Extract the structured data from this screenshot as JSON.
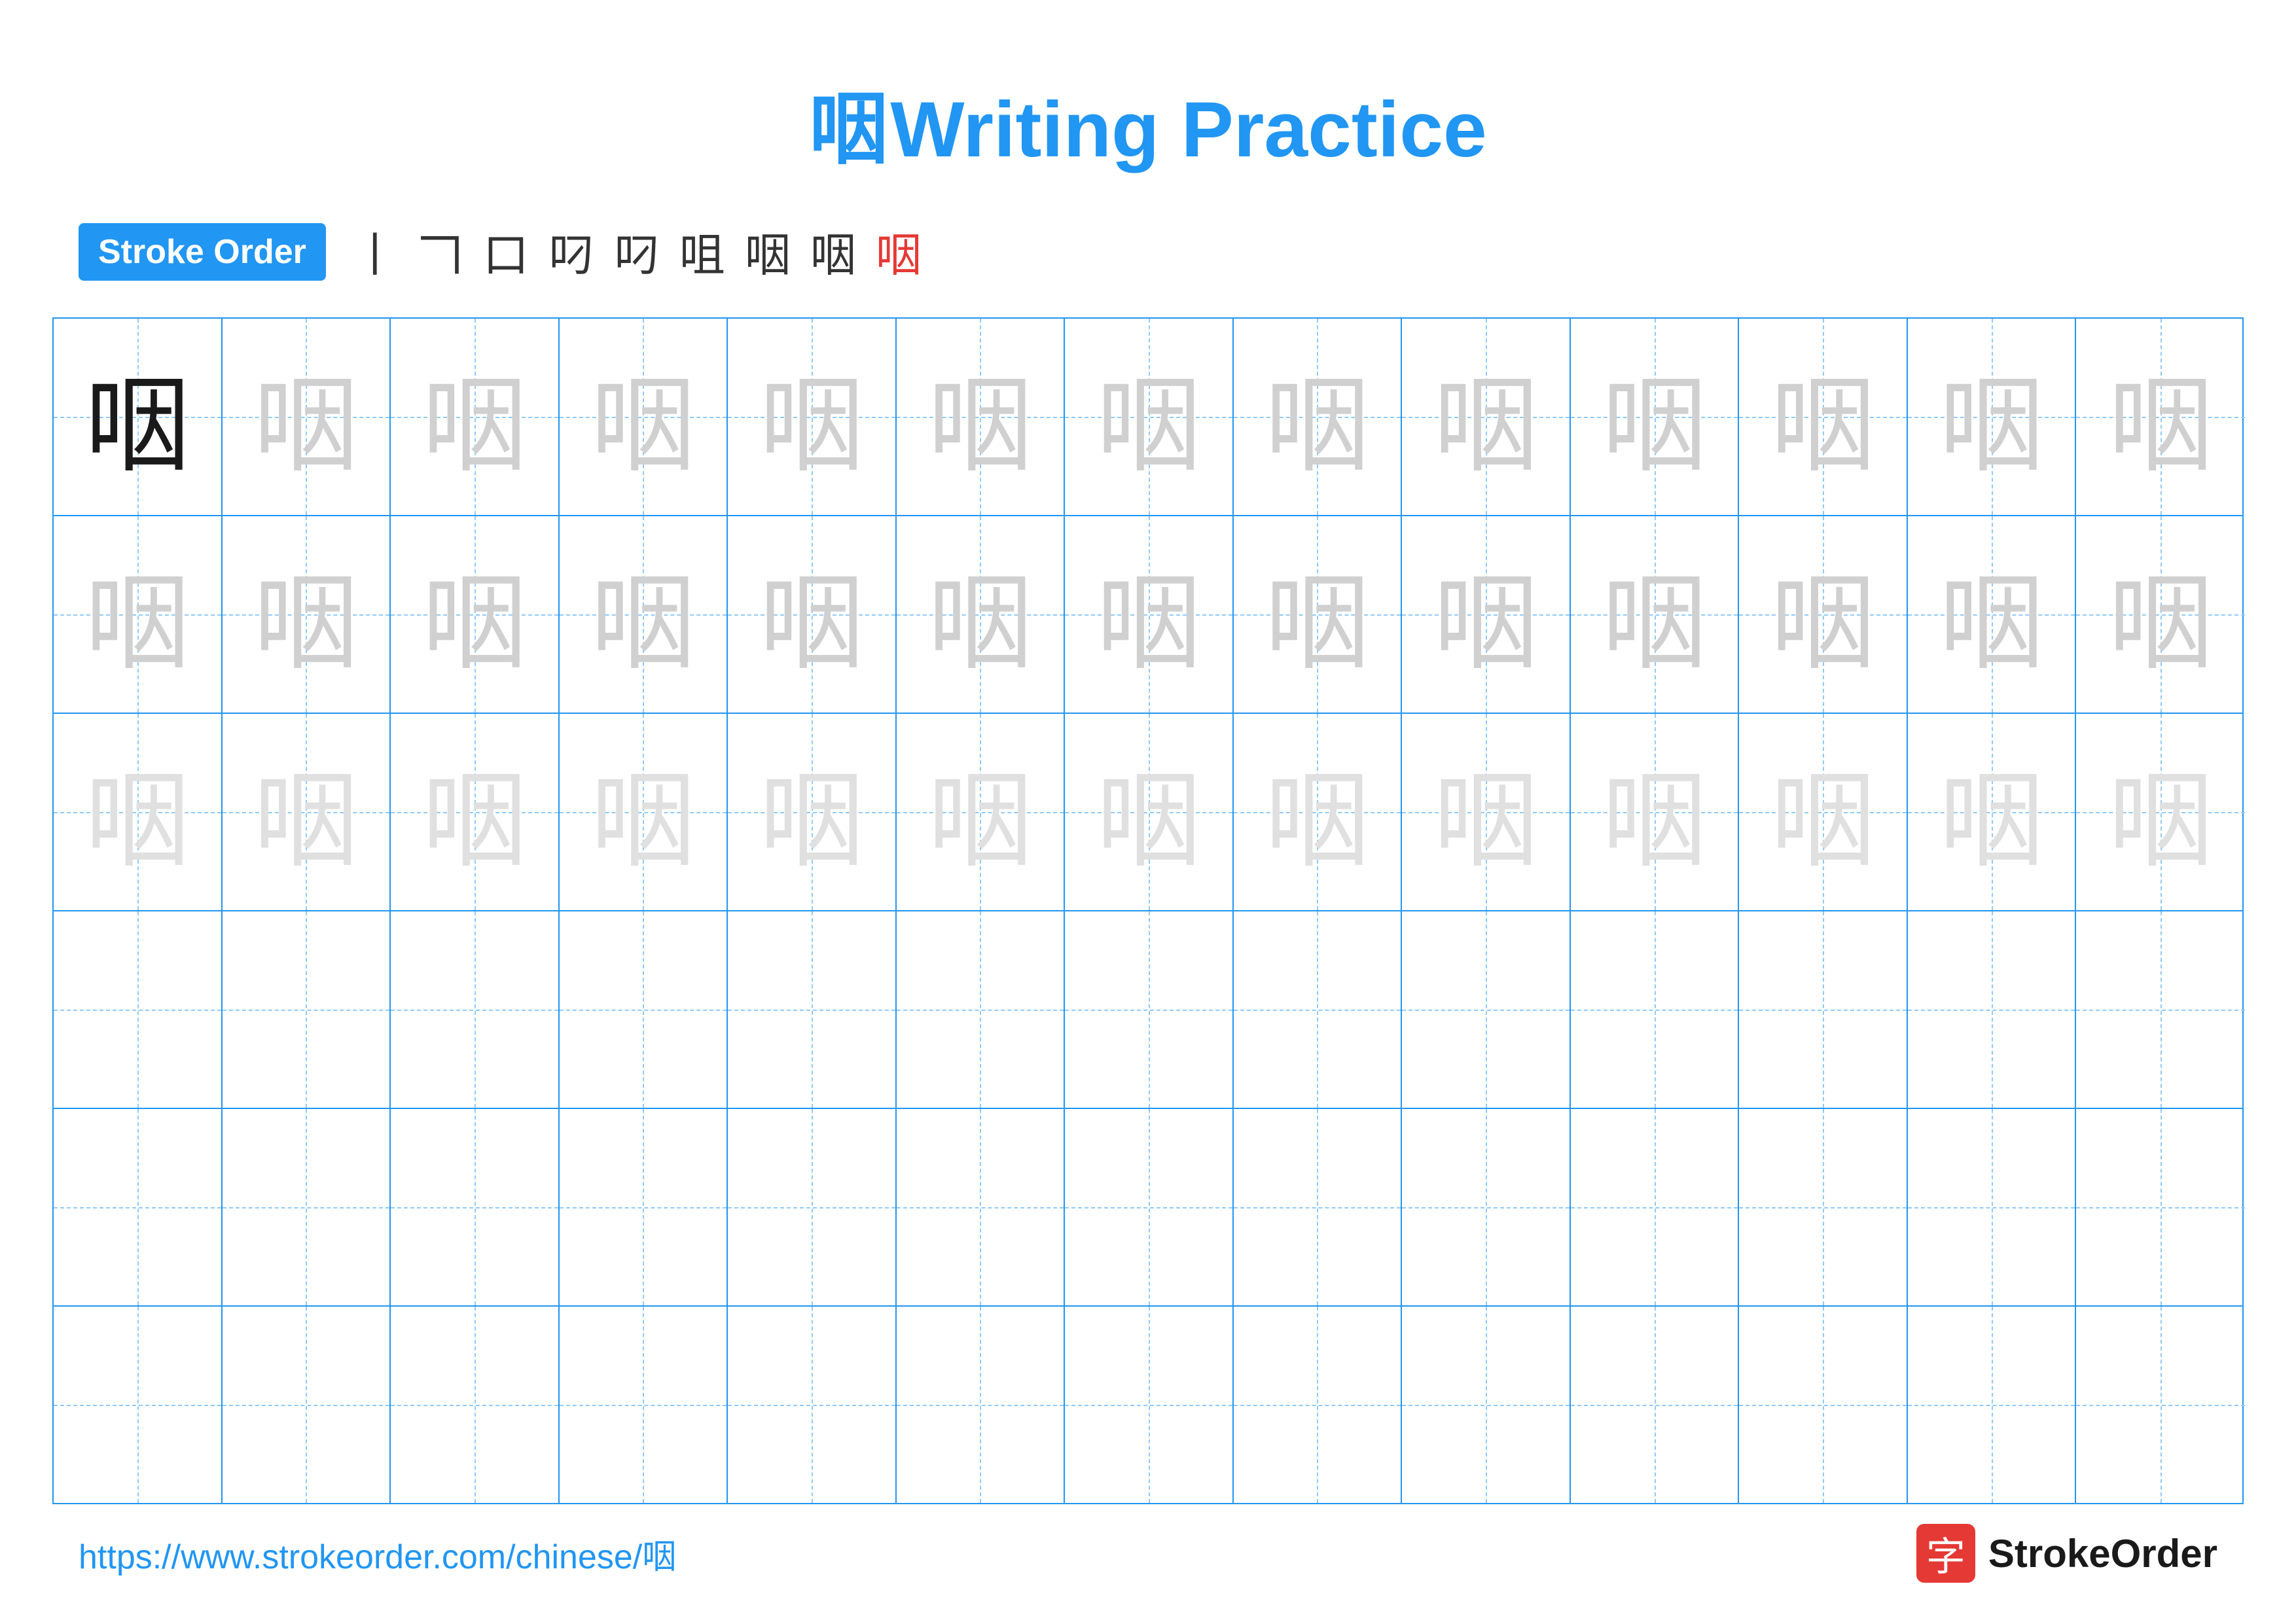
{
  "title": {
    "char": "咽",
    "text": "Writing Practice"
  },
  "stroke_order": {
    "badge_label": "Stroke Order",
    "steps": [
      "丨",
      "𠃍",
      "口",
      "叼",
      "叼",
      "咀",
      "咽",
      "咽",
      "咽"
    ]
  },
  "grid": {
    "rows": 6,
    "cols": 13,
    "char": "咽",
    "row_types": [
      "solid-then-light",
      "light",
      "lighter",
      "empty",
      "empty",
      "empty"
    ]
  },
  "footer": {
    "url": "https://www.strokeorder.com/chinese/咽",
    "logo_char": "字",
    "logo_text": "StrokeOrder"
  }
}
